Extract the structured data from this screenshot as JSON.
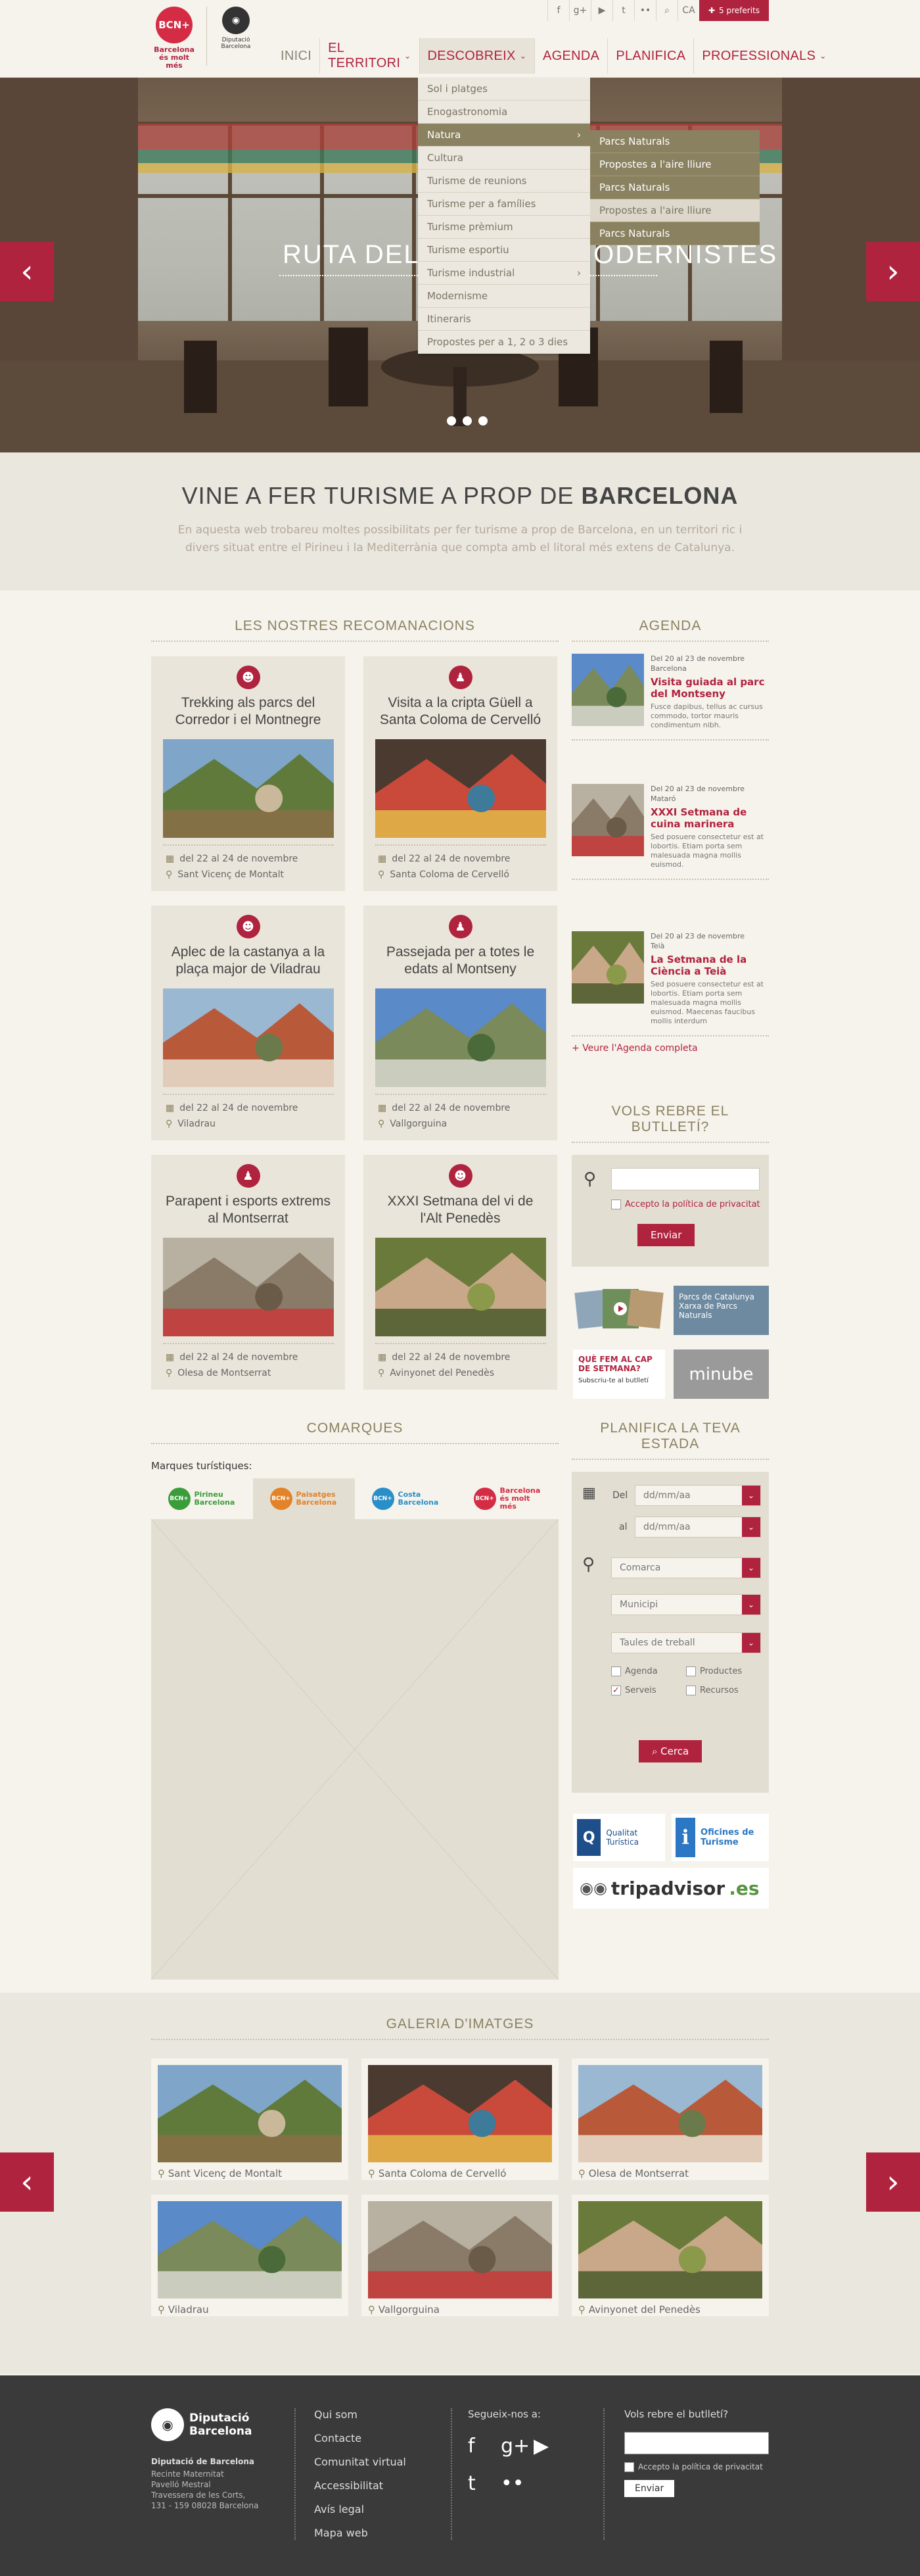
{
  "header": {
    "fav_label": "5 preferits",
    "lang": "CA",
    "logo_text": "Barcelona és molt més",
    "logo_badge": "BCN+",
    "dip_text": "Diputació Barcelona",
    "nav": [
      {
        "label": "INICI"
      },
      {
        "label": "EL TERRITORI"
      },
      {
        "label": "DESCOBREIX"
      },
      {
        "label": "AGENDA"
      },
      {
        "label": "PLANIFICA"
      },
      {
        "label": "PROFESSIONALS"
      }
    ]
  },
  "dropdown": {
    "items": [
      "Sol i platges",
      "Enogastronomia",
      "Natura",
      "Cultura",
      "Turisme de reunions",
      "Turisme per a famílies",
      "Turisme prèmium",
      "Turisme esportiu",
      "Turisme industrial",
      "Modernisme",
      "Itineraris",
      "Propostes per a 1, 2 o 3 dies"
    ],
    "submenu": [
      "Parcs Naturals",
      "Propostes a l'aire lliure",
      "Parcs Naturals",
      "Propostes a l'aire lliure",
      "Parcs Naturals"
    ]
  },
  "hero": {
    "caption": "RUTA DELS SALONS MODERNISTES"
  },
  "intro": {
    "title_plain": "VINE A FER TURISME A PROP DE",
    "title_bold": "BARCELONA",
    "text": "En aquesta web trobareu moltes possibilitats per fer turisme a prop de Barcelona, en un territori ric i divers situat entre el Pirineu i la Mediterrània que compta amb el litoral més extens de Catalunya."
  },
  "reco": {
    "title": "LES NOSTRES RECOMANACIONS",
    "cards": [
      {
        "title": "Trekking als parcs del Corredor i el Montnegre",
        "date": "del 22 al 24 de novembre",
        "place": "Sant Vicenç de Montalt",
        "icon": "hiker-icon"
      },
      {
        "title": "Visita a la cripta Güell a Santa Coloma de Cervelló",
        "date": "del 22 al 24 de novembre",
        "place": "Santa Coloma de Cervelló",
        "icon": "family-icon"
      },
      {
        "title": "Aplec de la castanya a la plaça major de Viladrau",
        "date": "del 22 al 24 de novembre",
        "place": "Viladrau",
        "icon": "hiker-icon"
      },
      {
        "title": "Passejada per a totes le edats al Montseny",
        "date": "del 22 al 24 de novembre",
        "place": "Vallgorguina",
        "icon": "family-icon"
      },
      {
        "title": "Parapent i esports extrems al Montserrat",
        "date": "del 22 al 24 de novembre",
        "place": "Olesa de Montserrat",
        "icon": "family-icon"
      },
      {
        "title": "XXXI Setmana del vi de l'Alt Penedès",
        "date": "del 22 al 24 de novembre",
        "place": "Avinyonet del Penedès",
        "icon": "hiker-icon"
      }
    ]
  },
  "agenda": {
    "title": "AGENDA",
    "items": [
      {
        "date": "Del 20 al 23 de novembre",
        "place": "Barcelona",
        "title": "Visita guiada al parc del Montseny",
        "desc": "Fusce dapibus, tellus ac cursus commodo, tortor mauris condimentum nibh."
      },
      {
        "date": "Del 20 al 23 de novembre",
        "place": "Mataró",
        "title": "XXXI Setmana de cuina marinera",
        "desc": "Sed posuere consectetur est at lobortis. Etiam porta sem malesuada magna mollis euismod."
      },
      {
        "date": "Del 20 al 23 de novembre",
        "place": "Teià",
        "title": "La Setmana de la Ciència a Teià",
        "desc": "Sed posuere consectetur est at lobortis. Etiam porta sem malesuada magna mollis euismod. Maecenas faucibus mollis interdum"
      }
    ],
    "more": "Veure l'Agenda completa"
  },
  "newsletter": {
    "title": "VOLS REBRE EL BUTLLETÍ?",
    "accept": "Accepto la política de privacitat",
    "button": "Enviar"
  },
  "banners": {
    "b1_text": "Parcs de Catalunya Xarxa de Parcs Naturals",
    "b2_text": "QUÈ FEM AL CAP DE SETMANA?",
    "b2_sub": "Subscriu-te al butlletí",
    "b3_text": "minube"
  },
  "comarques": {
    "title": "COMARQUES",
    "label": "Marques turístiques:",
    "tabs": [
      {
        "badge": "BCN+",
        "name": "Pirineu Barcelona",
        "color": "#3a9d3a"
      },
      {
        "badge": "BCN+",
        "name": "Paisatges Barcelona",
        "color": "#e2832a"
      },
      {
        "badge": "BCN+",
        "name": "Costa Barcelona",
        "color": "#2a8fc8"
      },
      {
        "badge": "BCN+",
        "name": "Barcelona és molt més",
        "color": "#d42c44"
      }
    ]
  },
  "plan": {
    "title": "PLANIFICA LA TEVA ESTADA",
    "del_label": "Del",
    "al_label": "al",
    "date_placeholder": "dd/mm/aa",
    "comarca": "Comarca",
    "municipi": "Municipi",
    "taules": "Taules de treball",
    "checks": [
      {
        "label": "Agenda",
        "checked": false
      },
      {
        "label": "Productes",
        "checked": false
      },
      {
        "label": "Serveis",
        "checked": true
      },
      {
        "label": "Recursos",
        "checked": false
      }
    ],
    "button": "Cerca"
  },
  "logos": {
    "qualitat": "Qualitat Turística",
    "oficines": "Oficines de Turisme",
    "tripadvisor": "tripadvisor",
    "tripadvisor_tld": ".es"
  },
  "gallery": {
    "title": "GALERIA D'IMATGES",
    "items": [
      "Sant Vicenç de Montalt",
      "Santa Coloma de Cervelló",
      "Olesa de Montserrat",
      "Viladrau",
      "Vallgorguina",
      "Avinyonet del Penedès"
    ]
  },
  "footer": {
    "org": "Diputació Barcelona",
    "address_title": "Diputació de Barcelona",
    "address": [
      "Recinte Maternitat",
      "Pavelló Mestral",
      "Travessera de les Corts,",
      "131 - 159 08028 Barcelona"
    ],
    "links": [
      "Qui som",
      "Contacte",
      "Comunitat virtual",
      "Accessibilitat",
      "Avís legal",
      "Mapa web"
    ],
    "social_title": "Segueix-nos a:",
    "news_title": "Vols rebre el butlletí?",
    "accept": "Accepto la política de privacitat",
    "button": "Enviar"
  },
  "colors": {
    "accent": "#b0233f",
    "olive": "#8a8160",
    "background": "#f6f3ec"
  }
}
